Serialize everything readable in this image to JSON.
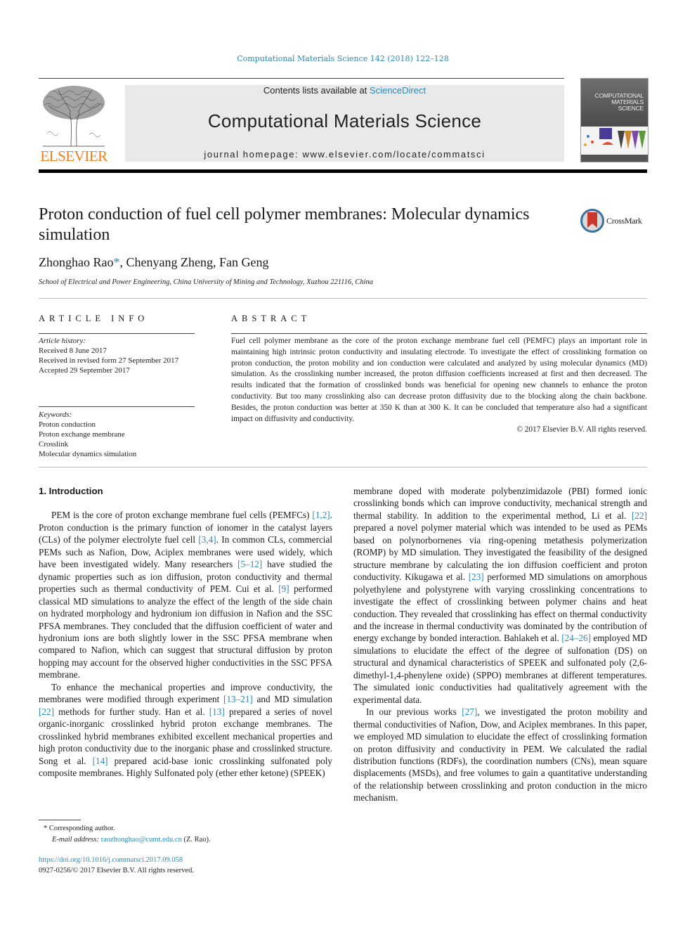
{
  "journal_citation": "Computational Materials Science 142 (2018) 122–128",
  "banner": {
    "contents_prefix": "Contents lists available at ",
    "contents_link": "ScienceDirect",
    "journal_title": "Computational Materials Science",
    "homepage": "journal homepage: www.elsevier.com/locate/commatsci"
  },
  "publisher_logo_text": "ELSEVIER",
  "cover": {
    "title_lines": [
      "COMPUTATIONAL",
      "MATERIALS",
      "SCIENCE"
    ]
  },
  "article": {
    "title": "Proton conduction of fuel cell polymer membranes: Molecular dynamics simulation",
    "crossmark_label": "CrossMark",
    "authors": [
      {
        "name": "Zhonghao Rao",
        "mark": "*"
      },
      {
        "name": "Chenyang Zheng",
        "mark": ""
      },
      {
        "name": "Fan Geng",
        "mark": ""
      }
    ],
    "affiliation": "School of Electrical and Power Engineering, China University of Mining and Technology, Xuzhou 221116, China"
  },
  "article_info": {
    "heading": "ARTICLE INFO",
    "history_label": "Article history:",
    "history": [
      "Received 8 June 2017",
      "Received in revised form 27 September 2017",
      "Accepted 29 September 2017"
    ],
    "keywords_label": "Keywords:",
    "keywords": [
      "Proton conduction",
      "Proton exchange membrane",
      "Crosslink",
      "Molecular dynamics simulation"
    ]
  },
  "abstract": {
    "heading": "ABSTRACT",
    "text": "Fuel cell polymer membrane as the core of the proton exchange membrane fuel cell (PEMFC) plays an important role in maintaining high intrinsic proton conductivity and insulating electrode. To investigate the effect of crosslinking formation on proton conduction, the proton mobility and ion conduction were calculated and analyzed by using molecular dynamics (MD) simulation. As the crosslinking number increased, the proton diffusion coefficients increased at first and then decreased. The results indicated that the formation of crosslinked bonds was beneficial for opening new channels to enhance the proton conductivity. But too many crosslinking also can decrease proton diffusivity due to the blocking along the chain backbone. Besides, the proton conduction was better at 350 K than at 300 K. It can be concluded that temperature also had a significant impact on diffusivity and conductivity.",
    "copyright": "© 2017 Elsevier B.V. All rights reserved."
  },
  "body": {
    "section_heading": "1. Introduction",
    "left_paragraphs": [
      [
        {
          "t": "PEM is the core of proton exchange membrane fuel cells (PEMFCs) "
        },
        {
          "ref": "[1,2]"
        },
        {
          "t": ". Proton conduction is the primary function of ionomer in the catalyst layers (CLs) of the polymer electrolyte fuel cell "
        },
        {
          "ref": "[3,4]"
        },
        {
          "t": ". In common CLs, commercial PEMs such as Nafion, Dow, Aciplex membranes were used widely, which have been investigated widely. Many researchers "
        },
        {
          "ref": "[5–12]"
        },
        {
          "t": " have studied the dynamic properties such as ion diffusion, proton conductivity and thermal properties such as thermal conductivity of PEM. Cui et al. "
        },
        {
          "ref": "[9]"
        },
        {
          "t": " performed classical MD simulations to analyze the effect of the length of the side chain on hydrated morphology and hydronium ion diffusion in Nafion and the SSC PFSA membranes. They concluded that the diffusion coefficient of water and hydronium ions are both slightly lower in the SSC PFSA membrane when compared to Nafion, which can suggest that structural diffusion by proton hopping may account for the observed higher conductivities in the SSC PFSA membrane."
        }
      ],
      [
        {
          "t": "To enhance the mechanical properties and improve conductivity, the membranes were modified through experiment "
        },
        {
          "ref": "[13–21]"
        },
        {
          "t": " and MD simulation "
        },
        {
          "ref": "[22]"
        },
        {
          "t": " methods for further study. Han et al. "
        },
        {
          "ref": "[13]"
        },
        {
          "t": " prepared a series of novel organic-inorganic crosslinked hybrid proton exchange membranes. The crosslinked hybrid membranes exhibited excellent mechanical properties and high proton conductivity due to the inorganic phase and crosslinked structure. Song et al. "
        },
        {
          "ref": "[14]"
        },
        {
          "t": " prepared acid-base ionic crosslinking sulfonated poly composite membranes. Highly Sulfonated poly (ether ether ketone) (SPEEK)"
        }
      ]
    ],
    "right_paragraphs": [
      [
        {
          "t": "membrane doped with moderate polybenzimidazole (PBI) formed ionic crosslinking bonds which can improve conductivity, mechanical strength and thermal stability. In addition to the experimental method, Li et al. "
        },
        {
          "ref": "[22]"
        },
        {
          "t": " prepared a novel polymer material which was intended to be used as PEMs based on polynorbornenes via ring-opening metathesis polymerization (ROMP) by MD simulation. They investigated the feasibility of the designed structure membrane by calculating the ion diffusion coefficient and proton conductivity. Kikugawa et al. "
        },
        {
          "ref": "[23]"
        },
        {
          "t": " performed MD simulations on amorphous polyethylene and polystyrene with varying crosslinking concentrations to investigate the effect of crosslinking between polymer chains and heat conduction. They revealed that crosslinking has effect on thermal conductivity and the increase in thermal conductivity was dominated by the contribution of energy exchange by bonded interaction. Bahlakeh et al. "
        },
        {
          "ref": "[24–26]"
        },
        {
          "t": " employed MD simulations to elucidate the effect of the degree of sulfonation (DS) on structural and dynamical characteristics of SPEEK and sulfonated poly (2,6-dimethyl-1,4-phenylene oxide) (SPPO) membranes at different temperatures. The simulated ionic conductivities had qualitatively agreement with the experimental data."
        }
      ],
      [
        {
          "t": "In our previous works "
        },
        {
          "ref": "[27]"
        },
        {
          "t": ", we investigated the proton mobility and thermal conductivities of Nafion, Dow, and Aciplex membranes. In this paper, we employed MD simulation to elucidate the effect of crosslinking formation on proton diffusivity and conductivity in PEM. We calculated the radial distribution functions (RDFs), the coordination numbers (CNs), mean square displacements (MSDs), and free volumes to gain a quantitative understanding of the relationship between crosslinking and proton conduction in the micro mechanism."
        }
      ]
    ]
  },
  "footnotes": {
    "corresponding": "* Corresponding author.",
    "email_label": "E-mail address: ",
    "email": "raozhonghao@cumt.edu.cn",
    "email_suffix": " (Z. Rao).",
    "doi": "https://doi.org/10.1016/j.commatsci.2017.09.058",
    "issn_line": "0927-0256/© 2017 Elsevier B.V. All rights reserved."
  },
  "colors": {
    "link": "#2a8ab7",
    "elsevier_orange": "#f07c1c",
    "banner_grey": "#e9e9e9"
  }
}
